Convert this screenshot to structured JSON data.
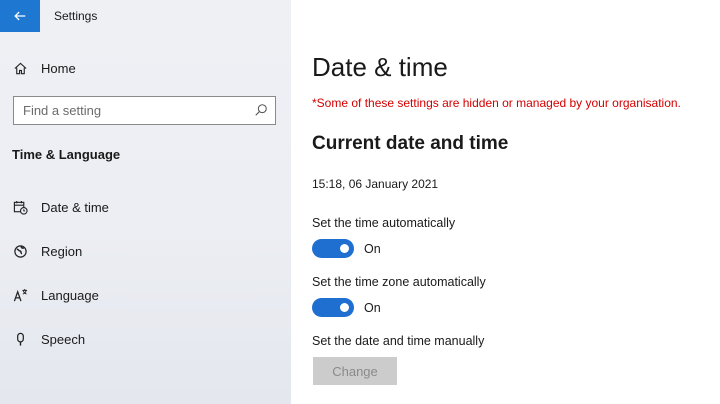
{
  "window": {
    "title": "Settings"
  },
  "sidebar": {
    "home_label": "Home",
    "search_placeholder": "Find a setting",
    "section_title": "Time & Language",
    "items": [
      {
        "label": "Date & time",
        "icon": "calendar-clock-icon"
      },
      {
        "label": "Region",
        "icon": "globe-icon"
      },
      {
        "label": "Language",
        "icon": "language-icon"
      },
      {
        "label": "Speech",
        "icon": "microphone-icon"
      }
    ]
  },
  "main": {
    "title": "Date & time",
    "warning": "*Some of these settings are hidden or managed by your organisation.",
    "section_title": "Current date and time",
    "current_datetime": "15:18, 06 January 2021",
    "auto_time": {
      "label": "Set the time automatically",
      "state": "On"
    },
    "auto_timezone": {
      "label": "Set the time zone automatically",
      "state": "On"
    },
    "manual": {
      "label": "Set the date and time manually",
      "button": "Change"
    }
  },
  "colors": {
    "accent": "#1e78d2",
    "toggle_on": "#1e6fd0",
    "warning": "#d40000",
    "sidebar_bg": "#eceef3"
  }
}
